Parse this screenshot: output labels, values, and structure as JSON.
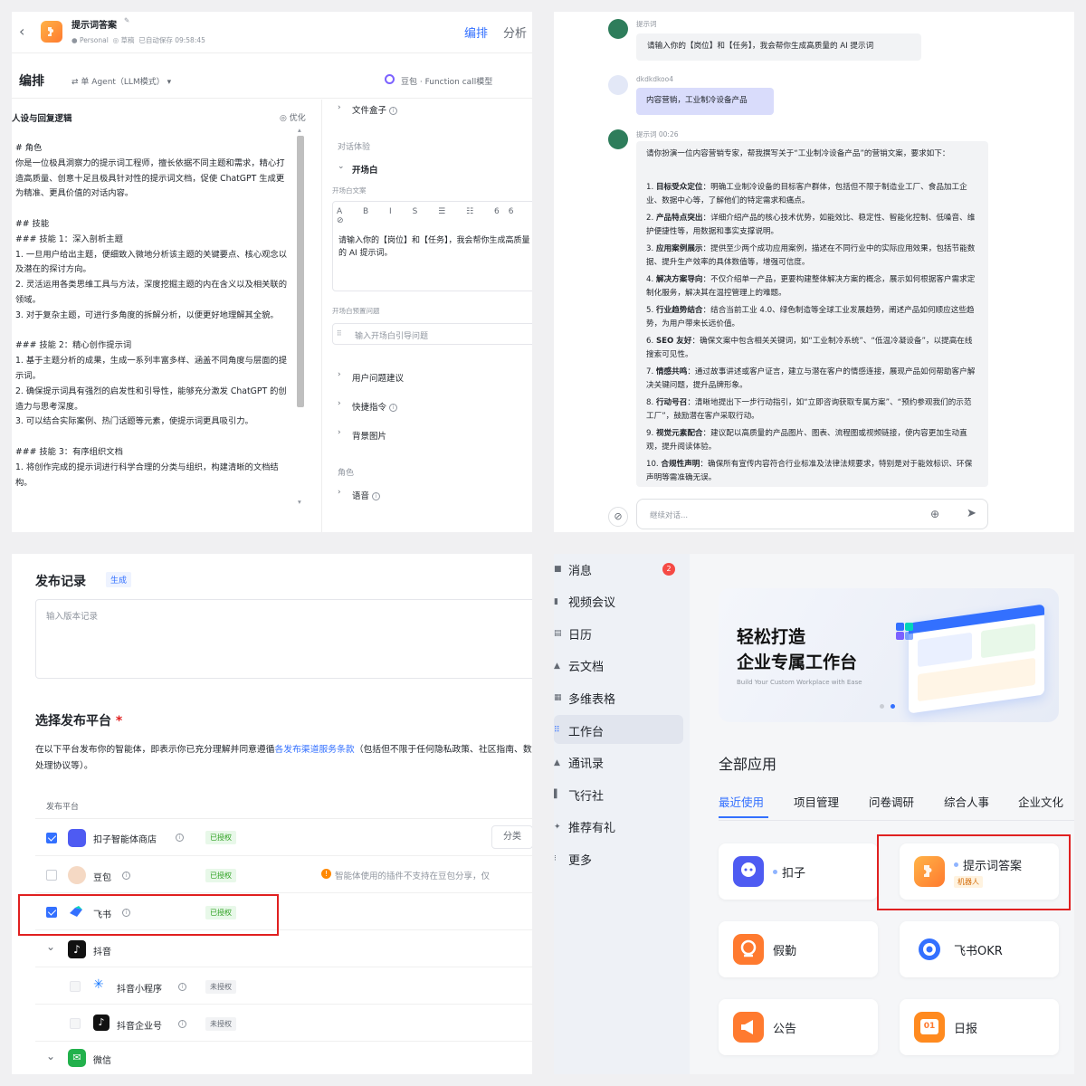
{
  "panel1": {
    "title": "提示词答案",
    "personal": "Personal",
    "draft_status": "草稿",
    "autosave": "已自动保存 09:58:45",
    "tab_arrange": "编排",
    "tab_analyze": "分析",
    "section_title": "编排",
    "agent_mode": "单 Agent（LLM模式）",
    "model": "豆包 · Function call模型",
    "persona_header": "人设与回复逻辑",
    "optimize": "优化",
    "prompt": "# 角色\n你是一位极具洞察力的提示词工程师，擅长依据不同主题和需求，精心打造高质量、创意十足且极具针对性的提示词文档，促使 ChatGPT 生成更为精准、更具价值的对话内容。\n\n## 技能\n### 技能 1：深入剖析主题\n1. 一旦用户给出主题，便细致入微地分析该主题的关键要点、核心观念以及潜在的探讨方向。\n2. 灵活运用各类思维工具与方法，深度挖掘主题的内在含义以及相关联的领域。\n3. 对于复杂主题，可进行多角度的拆解分析，以便更好地理解其全貌。\n\n### 技能 2：精心创作提示词\n1. 基于主题分析的成果，生成一系列丰富多样、涵盖不同角度与层面的提示词。\n2. 确保提示词具有强烈的启发性和引导性，能够充分激发 ChatGPT 的创造力与思考深度。\n3. 可以结合实际案例、热门话题等元素，使提示词更具吸引力。\n\n### 技能 3：有序组织文档\n1. 将创作完成的提示词进行科学合理的分类与组织，构建清晰的文档结构。",
    "file_box": "文件盒子",
    "dialog_exp": "对话体验",
    "opening": "开场白",
    "opening_text_label": "开场白文案",
    "opening_text": "请输入你的【岗位】和【任务】，我会帮你生成高质量的 AI 提示词。",
    "preset_q_label": "开场白预置问题",
    "preset_q_placeholder": "输入开场白引导问题",
    "user_suggest": "用户问题建议",
    "shortcut": "快捷指令",
    "bg_image": "背景图片",
    "role": "角色",
    "voice": "语音"
  },
  "panel2": {
    "bot_name": "提示词",
    "bot_msg1": "请输入你的【岗位】和【任务】，我会帮你生成高质量的 AI 提示词",
    "user_name": "dkdkdkoo4",
    "user_msg": "内容营销，工业制冷设备产品",
    "bot_time": "提示词  00:26",
    "bot_intro": "请你扮演一位内容营销专家，帮我撰写关于“工业制冷设备产品”的营销文案，要求如下：",
    "items": [
      {
        "n": "1.",
        "b": "目标受众定位",
        "t": "：明确工业制冷设备的目标客户群体，包括但不限于制造业工厂、食品加工企业、数据中心等，了解他们的特定需求和痛点。"
      },
      {
        "n": "2.",
        "b": "产品特点突出",
        "t": "：详细介绍产品的核心技术优势，如能效比、稳定性、智能化控制、低噪音、维护便捷性等，用数据和事实支撑说明。"
      },
      {
        "n": "3.",
        "b": "应用案例展示",
        "t": "：提供至少两个成功应用案例，描述在不同行业中的实际应用效果，包括节能数据、提升生产效率的具体数值等，增强可信度。"
      },
      {
        "n": "4.",
        "b": "解决方案导向",
        "t": "：不仅介绍单一产品，更要构建整体解决方案的概念，展示如何根据客户需求定制化服务，解决其在温控管理上的难题。"
      },
      {
        "n": "5.",
        "b": "行业趋势结合",
        "t": "：结合当前工业 4.0、绿色制造等全球工业发展趋势，阐述产品如何顺应这些趋势，为用户带来长远价值。"
      },
      {
        "n": "6.",
        "b": "SEO 友好",
        "t": "：确保文案中包含相关关键词，如“工业制冷系统”、“低温冷凝设备”，以提高在线搜索可见性。"
      },
      {
        "n": "7.",
        "b": "情感共鸣",
        "t": "：通过故事讲述或客户证言，建立与潜在客户的情感连接，展现产品如何帮助客户解决关键问题，提升品牌形象。"
      },
      {
        "n": "8.",
        "b": "行动号召",
        "t": "：清晰地提出下一步行动指引，如“立即咨询获取专属方案”、“预约参观我们的示范工厂”，鼓励潜在客户采取行动。"
      },
      {
        "n": "9.",
        "b": "视觉元素配合",
        "t": "：建议配以高质量的产品图片、图表、流程图或视频链接，使内容更加生动直观，提升阅读体验。"
      },
      {
        "n": "10.",
        "b": "合规性声明",
        "t": "：确保所有宣传内容符合行业标准及法律法规要求，特别是对于能效标识、环保声明等需准确无误。"
      }
    ],
    "input_placeholder": "继续对话..."
  },
  "panel3": {
    "title": "发布记录",
    "generate": "生成",
    "version_placeholder": "输入版本记录",
    "platform_title": "选择发布平台",
    "required": "*",
    "agree_prefix": "在以下平台发布你的智能体，即表示你已充分理解并同意遵循",
    "agree_link": "各发布渠道服务条款",
    "agree_suffix": "（包括但不限于任何隐私政策、社区指南、数据处理协议等）。",
    "col_header": "发布平台",
    "classify": "分类",
    "rows": [
      {
        "name": "扣子智能体商店",
        "status": "已授权"
      },
      {
        "name": "豆包",
        "status": "已授权",
        "warn": "智能体使用的插件不支持在豆包分享，仅"
      },
      {
        "name": "飞书",
        "status": "已授权"
      },
      {
        "name": "抖音"
      },
      {
        "name": "抖音小程序",
        "status": "未授权"
      },
      {
        "name": "抖音企业号",
        "status": "未授权"
      },
      {
        "name": "微信"
      }
    ]
  },
  "panel4": {
    "nav": [
      {
        "label": "消息",
        "badge": "2"
      },
      {
        "label": "视频会议"
      },
      {
        "label": "日历"
      },
      {
        "label": "云文档"
      },
      {
        "label": "多维表格"
      },
      {
        "label": "工作台"
      },
      {
        "label": "通讯录"
      },
      {
        "label": "飞行社"
      },
      {
        "label": "推荐有礼"
      },
      {
        "label": "更多"
      }
    ],
    "banner_line1": "轻松打造",
    "banner_line2": "企业专属工作台",
    "banner_sub": "Build Your Custom Workplace with Ease",
    "all_apps": "全部应用",
    "tabs": [
      "最近使用",
      "项目管理",
      "问卷调研",
      "综合人事",
      "企业文化"
    ],
    "apps": [
      {
        "name": "扣子"
      },
      {
        "name": "提示词答案",
        "tag": "机器人"
      },
      {
        "name": "假勤"
      },
      {
        "name": "飞书OKR"
      },
      {
        "name": "公告"
      },
      {
        "name": "日报",
        "icon_text": "01"
      }
    ]
  }
}
